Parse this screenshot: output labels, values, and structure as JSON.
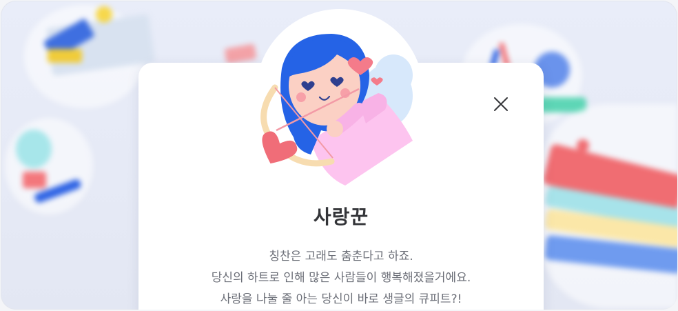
{
  "modal": {
    "title": "사랑꾼",
    "description_lines": [
      "칭찬은 고래도 춤춘다고 하죠.",
      "당신의 하트로 인해 많은 사람들이 행복해졌을거에요.",
      "사랑을 나눌 줄 아는 당신이 바로 생글의 큐피트?!"
    ],
    "close_icon": "close-icon",
    "badge_illustration": "cupid-badge-illustration"
  },
  "colors": {
    "title": "#333438",
    "text": "#6b6e77",
    "hair": "#2563e6",
    "skin": "#fbd0c4",
    "dress": "#fdc2ee",
    "heart": "#f36a7a",
    "wing": "#cfe3fb",
    "bow": "#f7d9a8"
  }
}
